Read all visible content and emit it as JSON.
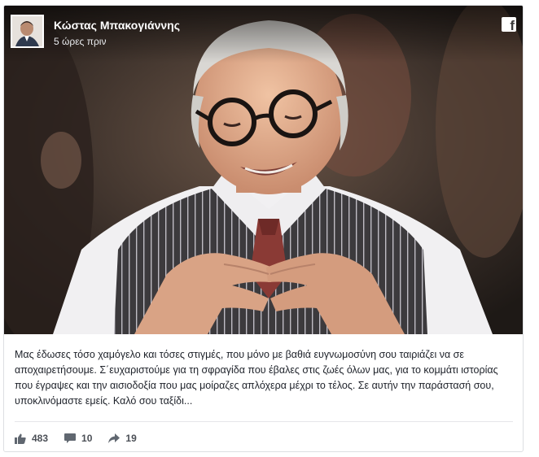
{
  "post": {
    "author": "Κώστας Μπακογιάννης",
    "timestamp": "5 ώρες πριν",
    "text": "Μας έδωσες τόσο χαμόγελο και τόσες στιγμές, που μόνο με βαθιά ευγνωμοσύνη σου ταιριάζει να σε αποχαιρετήσουμε. Σ΄ευχαριστούμε για τη σφραγίδα που έβαλες στις ζωές όλων μας, για το κομμάτι ιστορίας που έγραψες και την αισιοδοξία που μας μοίραζες απλόχερα μέχρι το τέλος. Σε αυτήν την παράστασή σου, υποκλινόμαστε εμείς. Καλό σου ταξίδι...",
    "likes": "483",
    "comments": "10",
    "shares": "19",
    "platform_icon": "facebook-icon"
  },
  "colors": {
    "text": "#1d2129",
    "muted": "#4b4f56",
    "stat_icon": "#606770"
  }
}
